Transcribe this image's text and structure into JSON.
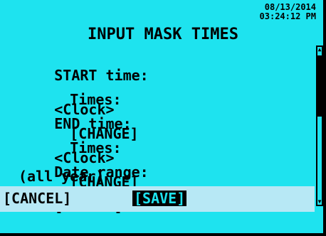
{
  "header": {
    "date": "08/13/2014",
    "time": "03:24:12 PM",
    "title": "INPUT MASK TIMES"
  },
  "fields": {
    "start_label": "START time:",
    "start_value": "<Clock>",
    "start_times_label": "Times:",
    "start_times_action": "[CHANGE]",
    "end_label": "END time:",
    "end_value": "<Clock>",
    "end_times_label": "Times:",
    "end_times_action": "[CHANGE]",
    "date_range_label": "Date range:",
    "date_range_action": "[CHANGE]",
    "date_range_value": "(all year)"
  },
  "actions": {
    "cancel_label": "[CANCEL]",
    "save_label": "[SAVE]"
  },
  "colors": {
    "lcd_background": "#1ee3ef",
    "highlight_row": "#b7e8f5",
    "text": "#000000"
  }
}
